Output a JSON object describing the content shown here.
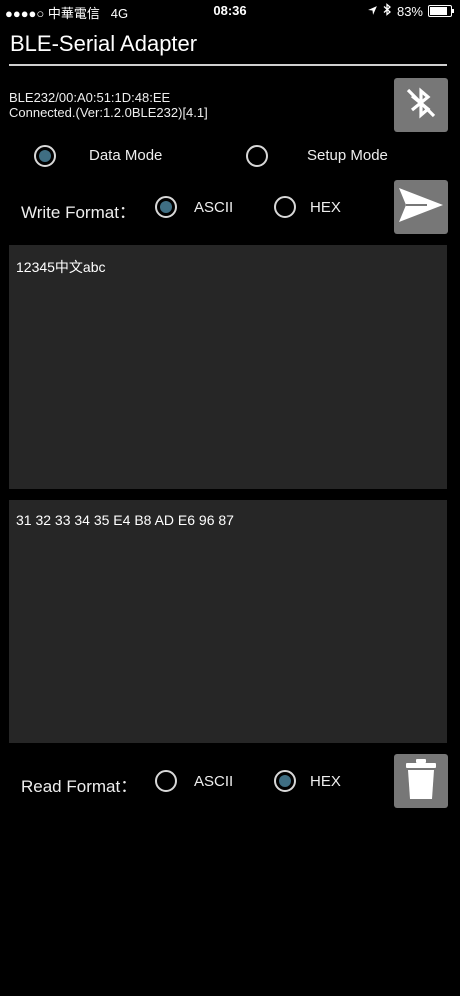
{
  "status_bar": {
    "carrier": "●●●●○ 中華電信",
    "network": "4G",
    "time": "08:36",
    "battery": "83%",
    "battery_level": 0.83
  },
  "app": {
    "title": "BLE-Serial Adapter"
  },
  "device": {
    "address": "BLE232/00:A0:51:1D:48:EE",
    "connection": "Connected.(Ver:1.2.0BLE232)[4.1]"
  },
  "modes": {
    "data_mode_label": "Data Mode",
    "setup_mode_label": "Setup Mode",
    "selected": "data"
  },
  "write_format": {
    "label": "Write Format：",
    "ascii_label": "ASCII",
    "hex_label": "HEX",
    "selected": "ascii"
  },
  "write_box": {
    "value": "12345中文abc"
  },
  "read_box": {
    "value": "31 32 33 34 35 E4 B8 AD E6 96 87"
  },
  "read_format": {
    "label": "Read Format：",
    "ascii_label": "ASCII",
    "hex_label": "HEX",
    "selected": "hex"
  },
  "colors": {
    "background": "#000000",
    "button_gray": "#777777",
    "textbox_bg": "#262626",
    "radio_dot": "#3f6e83"
  },
  "icons": {
    "bluetooth": "bluetooth-disabled-icon",
    "send": "send-icon",
    "trash": "trash-icon"
  }
}
